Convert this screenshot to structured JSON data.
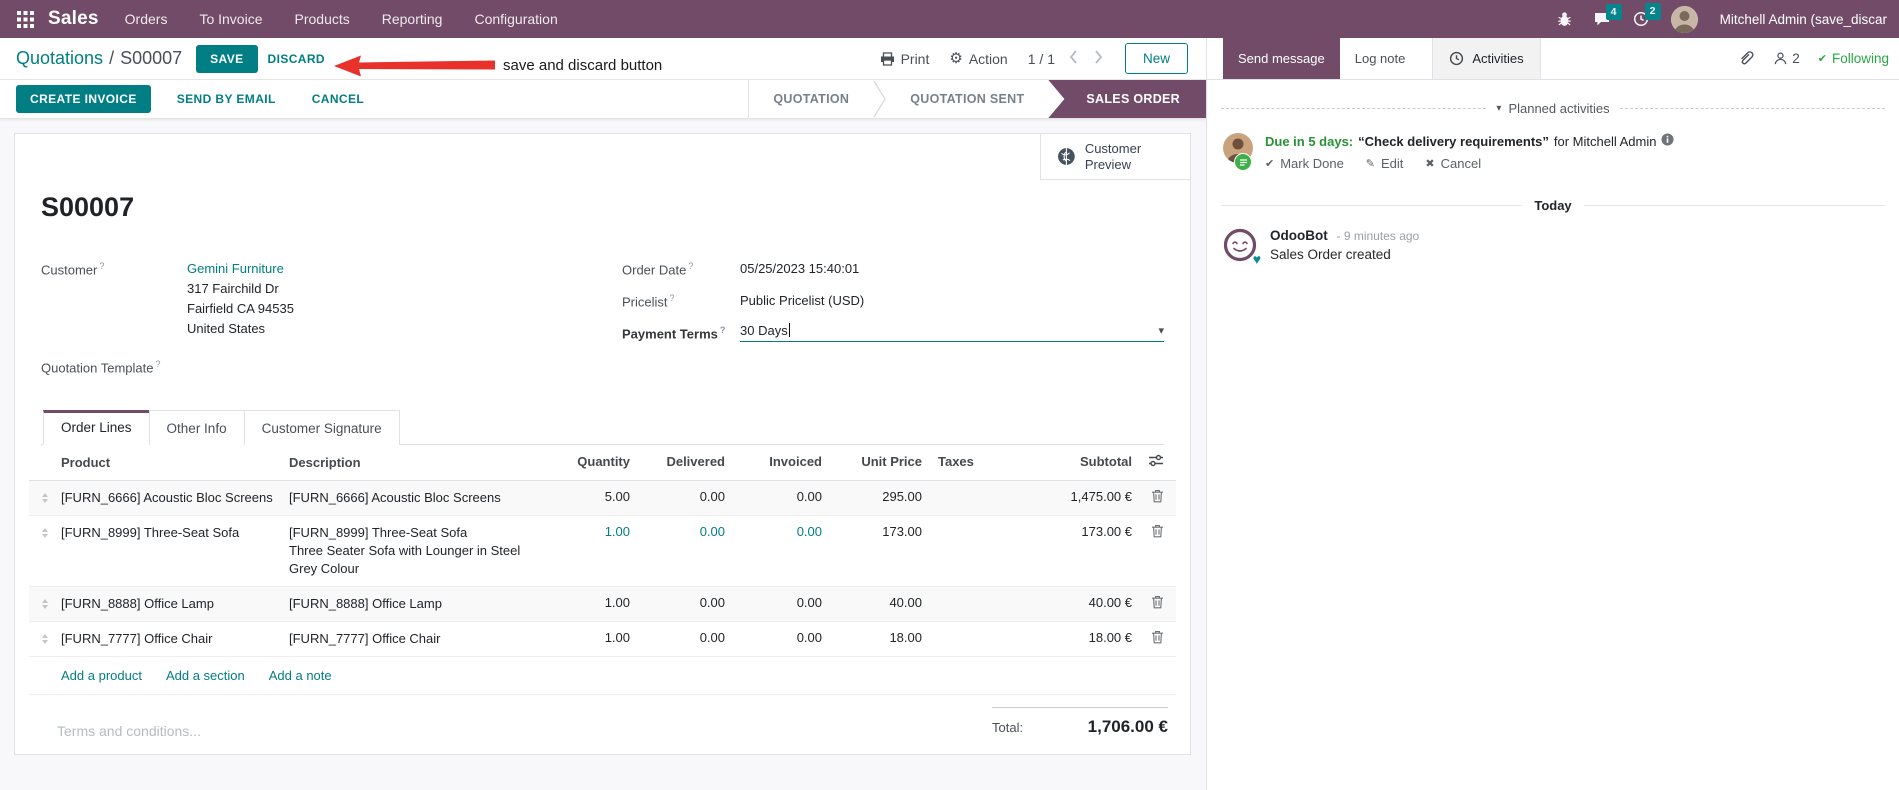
{
  "colors": {
    "brand_purple": "#714B67",
    "accent_teal": "#017E84",
    "success_green": "#28a745",
    "annotation_red": "#E8312A"
  },
  "icons": {
    "help": "?",
    "caret_down": "▾",
    "gear": "⚙",
    "check": "✔",
    "pencil": "✎",
    "cross": "✖",
    "heart": "♥"
  },
  "nav": {
    "brand": "Sales",
    "items": [
      "Orders",
      "To Invoice",
      "Products",
      "Reporting",
      "Configuration"
    ],
    "messages_badge": "4",
    "activities_badge": "2",
    "user_name": "Mitchell Admin (save_discar"
  },
  "control": {
    "breadcrumb_parent": "Quotations",
    "breadcrumb_sep": "/",
    "breadcrumb_current": "S00007",
    "save": "SAVE",
    "discard": "DISCARD",
    "print": "Print",
    "action": "Action",
    "pager": "1 / 1",
    "new": "New"
  },
  "annotation": {
    "label": "save and discard button"
  },
  "statusbar": {
    "create_invoice": "CREATE INVOICE",
    "send_by_email": "SEND BY EMAIL",
    "cancel": "CANCEL",
    "states": [
      "QUOTATION",
      "QUOTATION SENT",
      "SALES ORDER"
    ],
    "active_state": "SALES ORDER"
  },
  "sheet": {
    "customer_preview": "Customer Preview",
    "record_name": "S00007",
    "customer_label": "Customer",
    "customer_name": "Gemini Furniture",
    "address_line1": "317 Fairchild Dr",
    "address_line2": "Fairfield CA 94535",
    "address_line3": "United States",
    "quotation_template_label": "Quotation Template",
    "order_date_label": "Order Date",
    "order_date_value": "05/25/2023 15:40:01",
    "pricelist_label": "Pricelist",
    "pricelist_value": "Public Pricelist (USD)",
    "payment_terms_label": "Payment Terms",
    "payment_terms_value": "30 Days",
    "tabs": [
      "Order Lines",
      "Other Info",
      "Customer Signature"
    ],
    "active_tab": "Order Lines",
    "table": {
      "headers": {
        "product": "Product",
        "description": "Description",
        "quantity": "Quantity",
        "delivered": "Delivered",
        "invoiced": "Invoiced",
        "unit_price": "Unit Price",
        "taxes": "Taxes",
        "subtotal": "Subtotal"
      },
      "rows": [
        {
          "product": "[FURN_6666] Acoustic Bloc Screens",
          "description": "[FURN_6666] Acoustic Bloc Screens",
          "description_line2": "",
          "quantity": "5.00",
          "delivered": "0.00",
          "invoiced": "0.00",
          "unit_price": "295.00",
          "taxes": "",
          "subtotal": "1,475.00 €"
        },
        {
          "product": "[FURN_8999] Three-Seat Sofa",
          "description": "[FURN_8999] Three-Seat Sofa",
          "description_line2": "Three Seater Sofa with Lounger in Steel Grey Colour",
          "quantity": "1.00",
          "delivered": "0.00",
          "invoiced": "0.00",
          "unit_price": "173.00",
          "taxes": "",
          "subtotal": "173.00 €"
        },
        {
          "product": "[FURN_8888] Office Lamp",
          "description": "[FURN_8888] Office Lamp",
          "description_line2": "",
          "quantity": "1.00",
          "delivered": "0.00",
          "invoiced": "0.00",
          "unit_price": "40.00",
          "taxes": "",
          "subtotal": "40.00 €"
        },
        {
          "product": "[FURN_7777] Office Chair",
          "description": "[FURN_7777] Office Chair",
          "description_line2": "",
          "quantity": "1.00",
          "delivered": "0.00",
          "invoiced": "0.00",
          "unit_price": "18.00",
          "taxes": "",
          "subtotal": "18.00 €"
        }
      ],
      "add_product": "Add a product",
      "add_section": "Add a section",
      "add_note": "Add a note"
    },
    "total_label": "Total:",
    "total_value": "1,706.00 €",
    "terms_placeholder": "Terms and conditions..."
  },
  "chatter": {
    "send_message": "Send message",
    "log_note": "Log note",
    "activities": "Activities",
    "followers_count": "2",
    "following": "Following",
    "planned": {
      "header": "Planned activities",
      "due": "Due in 5 days:",
      "summary": "“Check delivery requirements”",
      "assignee": "for Mitchell Admin",
      "mark_done": "Mark Done",
      "edit": "Edit",
      "cancel": "Cancel"
    },
    "today": "Today",
    "message": {
      "author": "OdooBot",
      "time": "- 9 minutes ago",
      "body": "Sales Order created"
    }
  }
}
